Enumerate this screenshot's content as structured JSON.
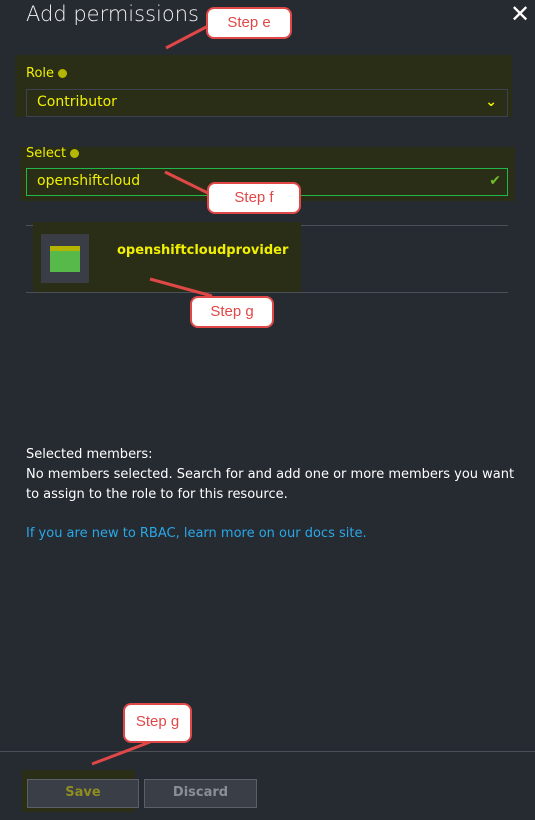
{
  "header": {
    "title": "Add permissions",
    "close_icon": "close-icon"
  },
  "role": {
    "label": "Role",
    "value": "Contributor"
  },
  "select": {
    "label": "Select",
    "value": "openshiftcloud"
  },
  "results": [
    {
      "name": "openshiftcloudprovider",
      "icon": "app-registration-icon"
    }
  ],
  "members": {
    "heading": "Selected members:",
    "message": "No members selected. Search for and add one or more members you want to assign to the role to for this resource."
  },
  "docs_link": "If you are new to RBAC, learn more on our docs site.",
  "footer": {
    "save_label": "Save",
    "discard_label": "Discard"
  },
  "annotations": {
    "step_e": "Step e",
    "step_f": "Step f",
    "step_g1": "Step g",
    "step_g2": "Step g"
  },
  "colors": {
    "background": "#262a31",
    "highlight": "#f0f000",
    "link": "#2aa8e8",
    "annotation": "#e04848"
  }
}
